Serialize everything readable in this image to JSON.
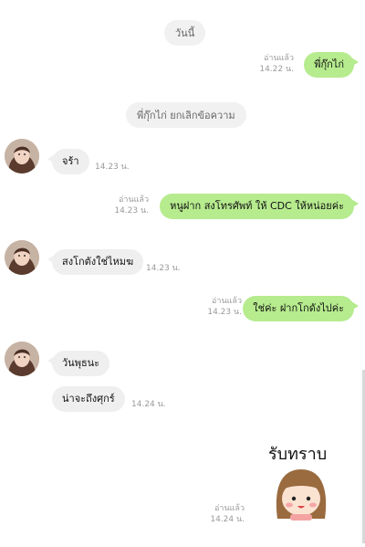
{
  "chat": {
    "date_label": "วันนี้",
    "system_notice": "พี่กุ๊กไก่ ยกเลิกข้อความ",
    "messages": [
      {
        "text": "พี่กุ๊กไก่",
        "read": "อ่านแล้ว",
        "time": "14.22 น."
      },
      {
        "text": "จร้า",
        "time": "14.23 น."
      },
      {
        "text": "หนูฝาก สงโทรศัพท์ ให้ CDC ให้หน่อยค่ะ",
        "read": "อ่านแล้ว",
        "time": "14.23 น."
      },
      {
        "text": "สงโกตังใช่ไหมฆ",
        "time": "14.23 น."
      },
      {
        "text": "ใช่ค่ะ ฝากโกดังไปค่ะ",
        "read": "อ่านแล้ว",
        "time": "14.23 น."
      },
      {
        "text": "วันพุธนะ"
      },
      {
        "text": "น่าจะถึงศุกร์",
        "time": "14.24 น."
      },
      {
        "read": "อ่านแล้ว",
        "time": "14.24 น."
      }
    ],
    "sticker": {
      "caption": "รับทราบ",
      "icon": "girl-face-sticker"
    }
  }
}
